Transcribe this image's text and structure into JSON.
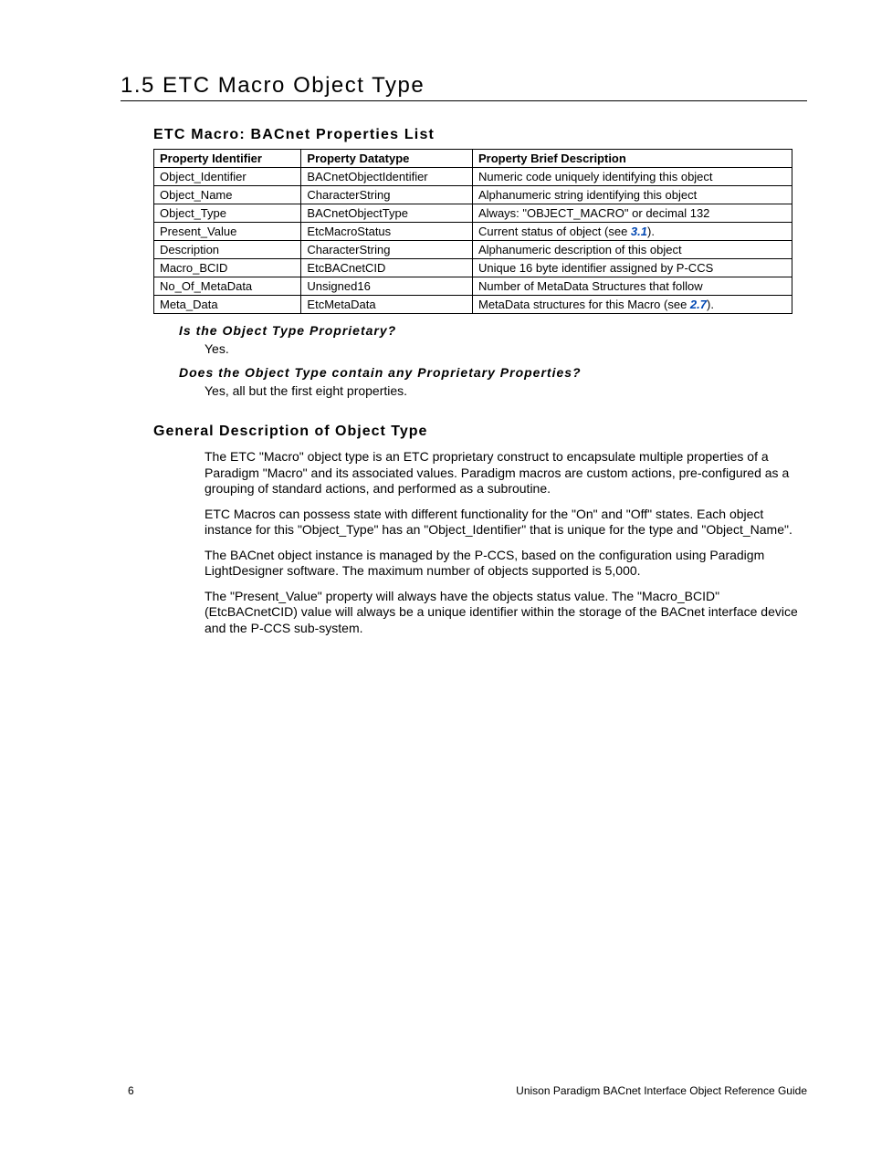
{
  "section": {
    "number": "1.5",
    "title": "ETC Macro Object Type"
  },
  "tableHeading": "ETC Macro: BACnet Properties List",
  "tableHeaders": {
    "col1": "Property Identifier",
    "col2": "Property Datatype",
    "col3": "Property Brief Description"
  },
  "tableRows": [
    {
      "id": "Object_Identifier",
      "dt": "BACnetObjectIdentifier",
      "desc": "Numeric code uniquely identifying this object"
    },
    {
      "id": "Object_Name",
      "dt": "CharacterString",
      "desc": "Alphanumeric string identifying this object"
    },
    {
      "id": "Object_Type",
      "dt": "BACnetObjectType",
      "desc": "Always: \"OBJECT_MACRO\" or decimal 132"
    },
    {
      "id": "Present_Value",
      "dt": "EtcMacroStatus",
      "desc_pre": "Current status of object (see ",
      "link": "3.1",
      "desc_post": ")."
    },
    {
      "id": "Description",
      "dt": "CharacterString",
      "desc": "Alphanumeric description of this object"
    },
    {
      "id": "Macro_BCID",
      "dt": "EtcBACnetCID",
      "desc": "Unique 16 byte identifier assigned by P-CCS"
    },
    {
      "id": "No_Of_MetaData",
      "dt": "Unsigned16",
      "desc": "Number of MetaData Structures that follow"
    },
    {
      "id": "Meta_Data",
      "dt": "EtcMetaData",
      "desc_pre": "MetaData structures for this Macro (see ",
      "link": "2.7",
      "desc_post": ")."
    }
  ],
  "q1": "Is the Object Type Proprietary?",
  "a1": "Yes.",
  "q2": "Does the Object Type contain any Proprietary Properties?",
  "a2": "Yes, all but the first eight properties.",
  "genHead": "General Description of Object Type",
  "p1": "The ETC \"Macro\" object type is an ETC proprietary construct to encapsulate multiple properties of a Paradigm \"Macro\" and its associated values. Paradigm macros are custom actions, pre-configured as a grouping of standard actions, and performed as a subroutine.",
  "p2": "ETC Macros can possess state with different functionality for the \"On\" and \"Off\" states. Each object instance for this \"Object_Type\" has an \"Object_Identifier\" that is unique for the type and \"Object_Name\".",
  "p3": "The BACnet object instance is managed by the P-CCS, based on the configuration using Paradigm LightDesigner software. The maximum number of objects supported is 5,000.",
  "p4": "The \"Present_Value\" property will always have the objects status value. The \"Macro_BCID\" (EtcBACnetCID) value will always be a unique identifier within the storage of the BACnet interface device and the P-CCS sub-system.",
  "footer": {
    "pageNum": "6",
    "docTitle": "Unison Paradigm BACnet Interface Object Reference Guide"
  }
}
